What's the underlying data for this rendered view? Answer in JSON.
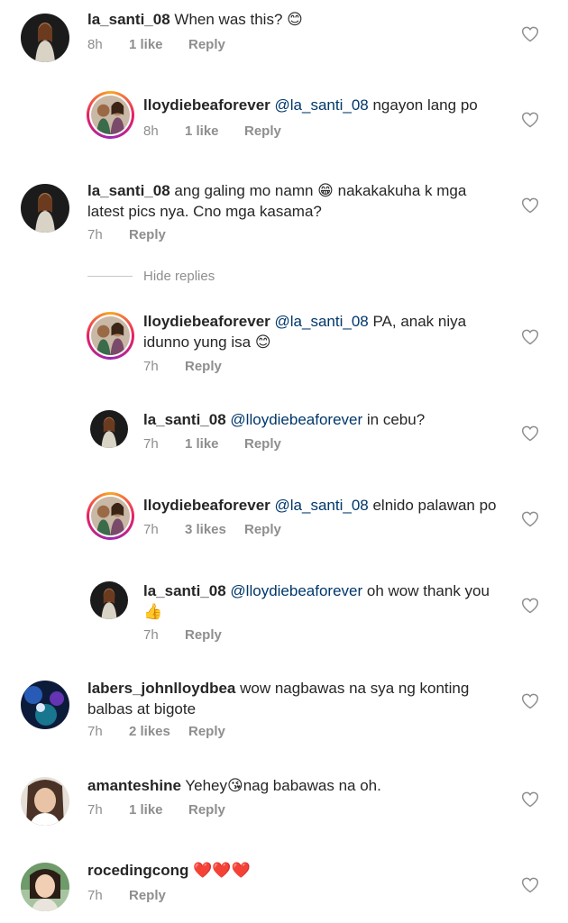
{
  "comments": [
    {
      "user": "la_santi_08",
      "mention": "",
      "text": " When was this? 😊",
      "time": "8h",
      "likes": "1 like",
      "reply": "Reply",
      "avatar": "dark-portrait"
    },
    {
      "user": "lloydiebeaforever",
      "mention": "@la_santi_08",
      "text": " ngayon lang po",
      "time": "8h",
      "likes": "1 like",
      "reply": "Reply",
      "avatar": "ring-couple"
    },
    {
      "user": "la_santi_08",
      "mention": "",
      "text": " ang galing mo namn 😁 nakakakuha k mga latest pics nya. Cno mga kasama?",
      "time": "7h",
      "likes": "",
      "reply": "Reply",
      "avatar": "dark-portrait"
    },
    {
      "user": "lloydiebeaforever",
      "mention": "@la_santi_08",
      "text": " PA, anak niya idunno yung isa 😊",
      "time": "7h",
      "likes": "",
      "reply": "Reply",
      "avatar": "ring-couple"
    },
    {
      "user": "la_santi_08",
      "mention": "@lloydiebeaforever",
      "text": " in cebu?",
      "time": "7h",
      "likes": "1 like",
      "reply": "Reply",
      "avatar": "dark-portrait"
    },
    {
      "user": "lloydiebeaforever",
      "mention": "@la_santi_08",
      "text": " elnido palawan po",
      "time": "7h",
      "likes": "3 likes",
      "reply": "Reply",
      "avatar": "ring-couple"
    },
    {
      "user": "la_santi_08",
      "mention": "@lloydiebeaforever",
      "text": " oh wow thank you 👍",
      "time": "7h",
      "likes": "",
      "reply": "Reply",
      "avatar": "dark-portrait"
    },
    {
      "user": "labers_johnlloydbea",
      "mention": "",
      "text": " wow nagbawas na sya ng konting balbas at bigote",
      "time": "7h",
      "likes": "2 likes",
      "reply": "Reply",
      "avatar": "blue-concert"
    },
    {
      "user": "amanteshine",
      "mention": "",
      "text": " Yehey😘nag babawas na oh.",
      "time": "7h",
      "likes": "1 like",
      "reply": "Reply",
      "avatar": "selfie"
    },
    {
      "user": "rocedingcong",
      "mention": "",
      "text": " ❤️❤️❤️",
      "time": "7h",
      "likes": "",
      "reply": "Reply",
      "avatar": "smiling-girl"
    }
  ],
  "hide_replies": "Hide replies",
  "colors": {
    "username": "#262626",
    "mention": "#00376b",
    "meta": "#8e8e8e",
    "heart": "#8e8e8e"
  },
  "icons": {
    "like": "heart-outline-icon"
  }
}
